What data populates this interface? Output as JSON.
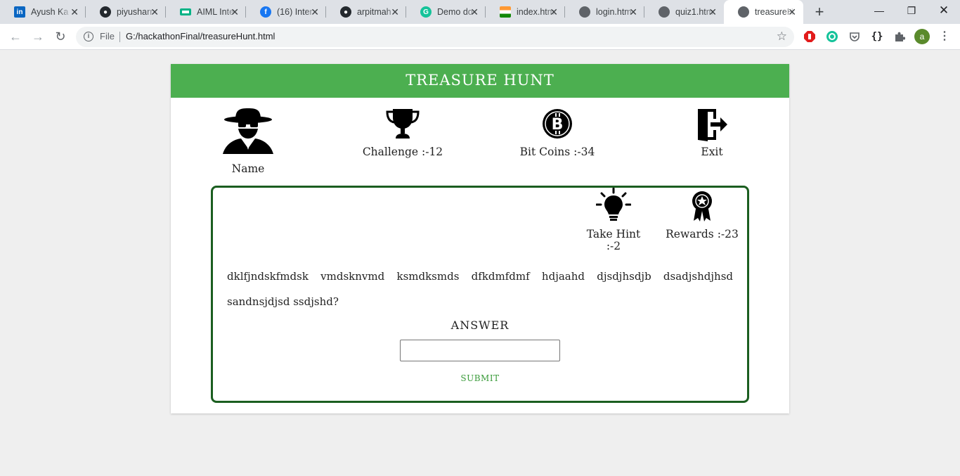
{
  "browser": {
    "tabs": [
      {
        "title": "Ayush Ka",
        "favicon": "linkedin-icon",
        "color": "#0a66c2"
      },
      {
        "title": "piyusharr",
        "favicon": "github-icon",
        "color": "#24292e"
      },
      {
        "title": "AIML Inte",
        "favicon": "aiml-icon",
        "color": "#00b386"
      },
      {
        "title": "(16) Inter",
        "favicon": "facebook-icon",
        "color": "#1877f2"
      },
      {
        "title": "arpitmah",
        "favicon": "github-icon",
        "color": "#24292e"
      },
      {
        "title": "Demo do",
        "favicon": "grammarly-icon",
        "color": "#15c39a"
      },
      {
        "title": "index.htm",
        "favicon": "india-flag-icon",
        "color": "#ff9933"
      },
      {
        "title": "login.htm",
        "favicon": "globe-icon",
        "color": "#5f6368"
      },
      {
        "title": "quiz1.htm",
        "favicon": "globe-icon",
        "color": "#5f6368"
      },
      {
        "title": "treasureH",
        "favicon": "globe-icon",
        "color": "#5f6368"
      }
    ],
    "active_tab": 9,
    "address": {
      "scheme_label": "File",
      "url": "G:/hackathonFinal/treasureHunt.html"
    }
  },
  "page": {
    "header": "TREASURE HUNT",
    "accent_color": "#4caf50",
    "panel_border_color": "#1b5e20",
    "stats": {
      "name": "Name",
      "challenge": "Challenge :-12",
      "bitcoins": "Bit Coins :-34",
      "exit": "Exit"
    },
    "hint_line1": "Take Hint",
    "hint_line2": ":-2",
    "rewards": "Rewards :-23",
    "question": "dklfjndskfmdsk vmdsknvmd ksmdksmds dfkdmfdmf hdjaahd djsdjhsdjb dsadjshdjhsd sandnsjdjsd ssdjshd?",
    "answer_label": "ANSWER",
    "answer_value": "",
    "submit_label": "SUBMIT"
  }
}
